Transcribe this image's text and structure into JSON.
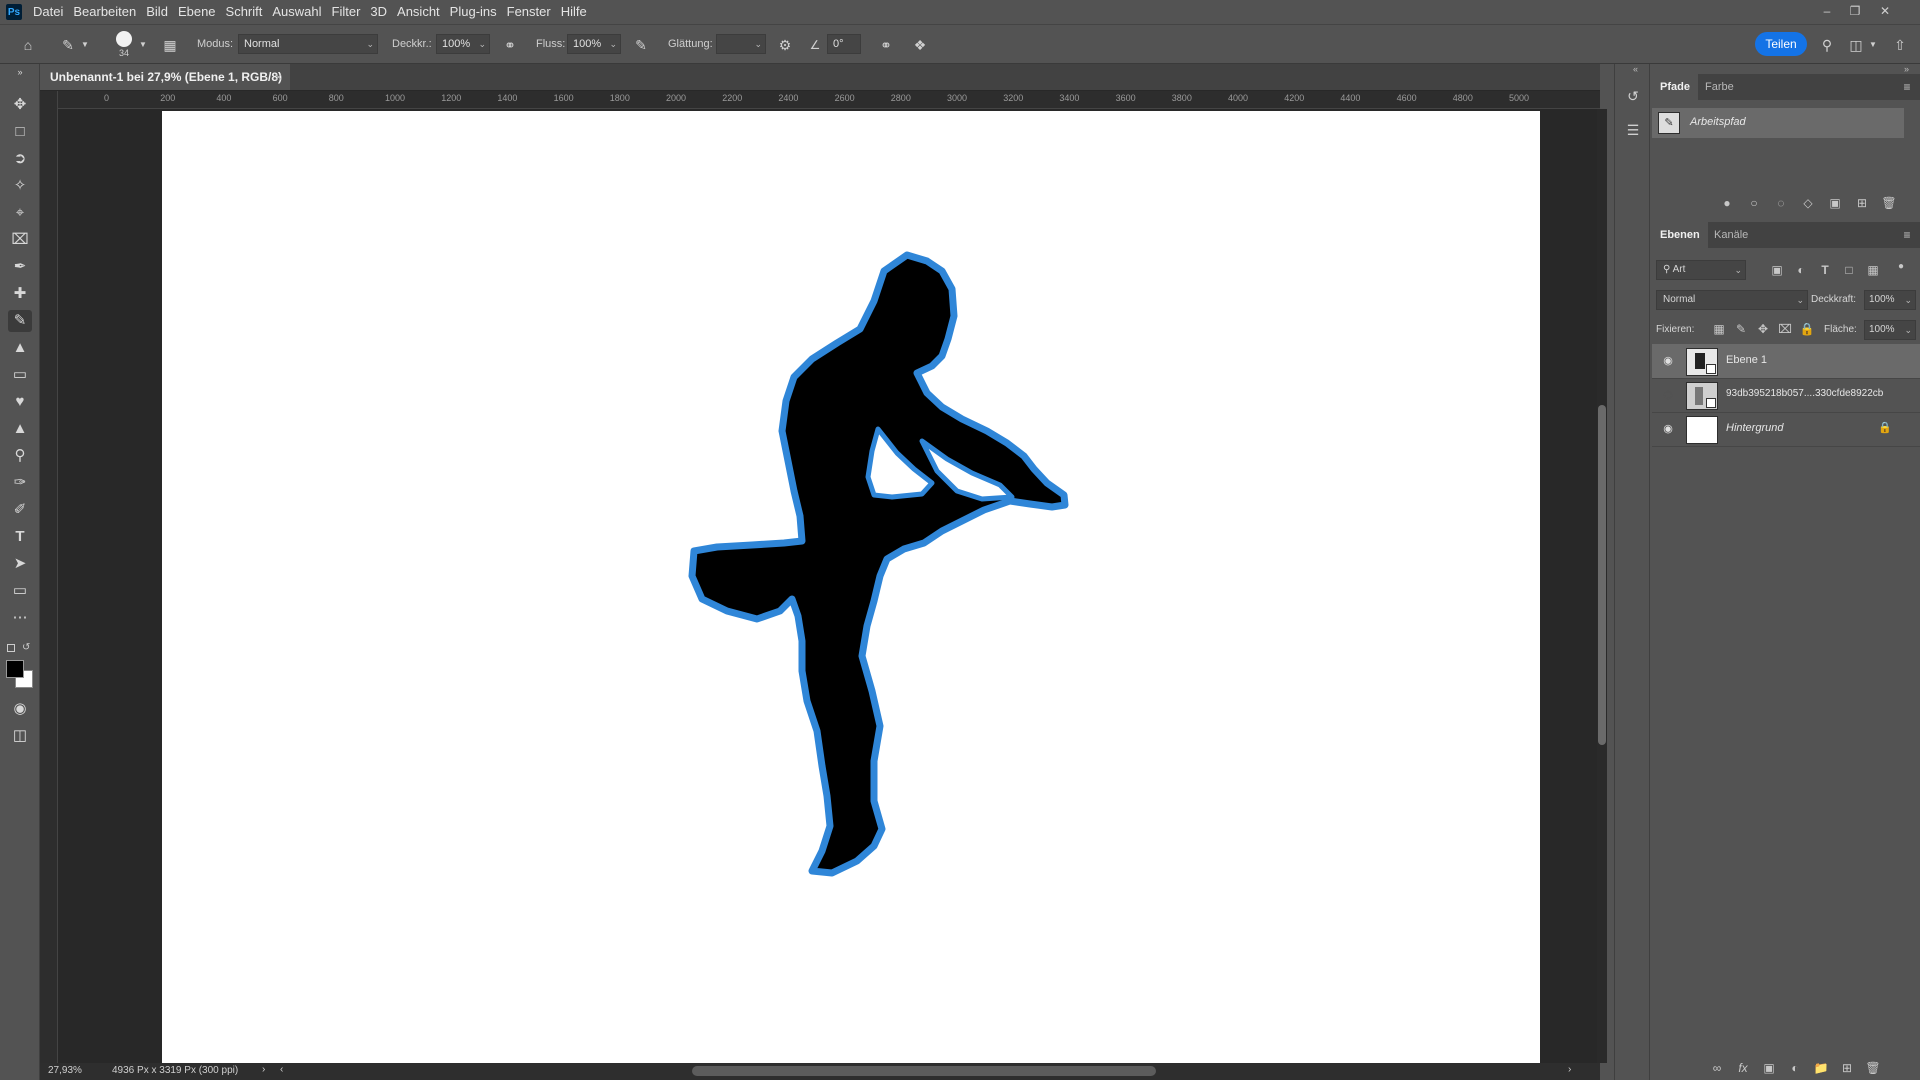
{
  "menubar": {
    "logo": "Ps",
    "items": [
      "Datei",
      "Bearbeiten",
      "Bild",
      "Ebene",
      "Schrift",
      "Auswahl",
      "Filter",
      "3D",
      "Ansicht",
      "Plug-ins",
      "Fenster",
      "Hilfe"
    ]
  },
  "options": {
    "brush_size": "34",
    "mode_label": "Modus:",
    "mode_value": "Normal",
    "opacity_label": "Deckkr.:",
    "opacity_value": "100%",
    "flow_label": "Fluss:",
    "flow_value": "100%",
    "smoothing_label": "Glättung:",
    "smoothing_value": "",
    "angle_value": "0°",
    "share_label": "Teilen"
  },
  "document": {
    "tab_title": "Unbenannt-1 bei 27,9% (Ebene 1, RGB/8) *",
    "ruler_labels": [
      "0",
      "200",
      "400",
      "600",
      "800",
      "1000",
      "1200",
      "1400",
      "1600",
      "1800",
      "2000",
      "2200",
      "2400",
      "2600",
      "2800",
      "3000",
      "3200",
      "3400",
      "3600",
      "3800",
      "4000",
      "4200",
      "4400",
      "4600",
      "4800",
      "5000"
    ],
    "zoom": "27,93%",
    "doc_info": "4936 Px x 3319 Px (300 ppi)"
  },
  "paths_panel": {
    "tabs": [
      "Pfade",
      "Farbe"
    ],
    "path_name": "Arbeitspfad"
  },
  "layers_panel": {
    "tabs": [
      "Ebenen",
      "Kanäle"
    ],
    "filter_kind": "Art",
    "blend_mode": "Normal",
    "opacity_label": "Deckkraft:",
    "opacity_value": "100%",
    "lock_label": "Fixieren:",
    "fill_label": "Fläche:",
    "fill_value": "100%",
    "layers": [
      {
        "name": "Ebene 1",
        "visible": true,
        "selected": true
      },
      {
        "name": "93db395218b057....330cfde8922cb",
        "visible": false,
        "selected": false
      },
      {
        "name": "Hintergrund",
        "visible": true,
        "selected": false,
        "locked": true
      }
    ]
  },
  "colors": {
    "accent": "#1473e6",
    "ui_bg": "#535353",
    "pasteboard": "#282828",
    "path_outline": "#2f86d8"
  }
}
